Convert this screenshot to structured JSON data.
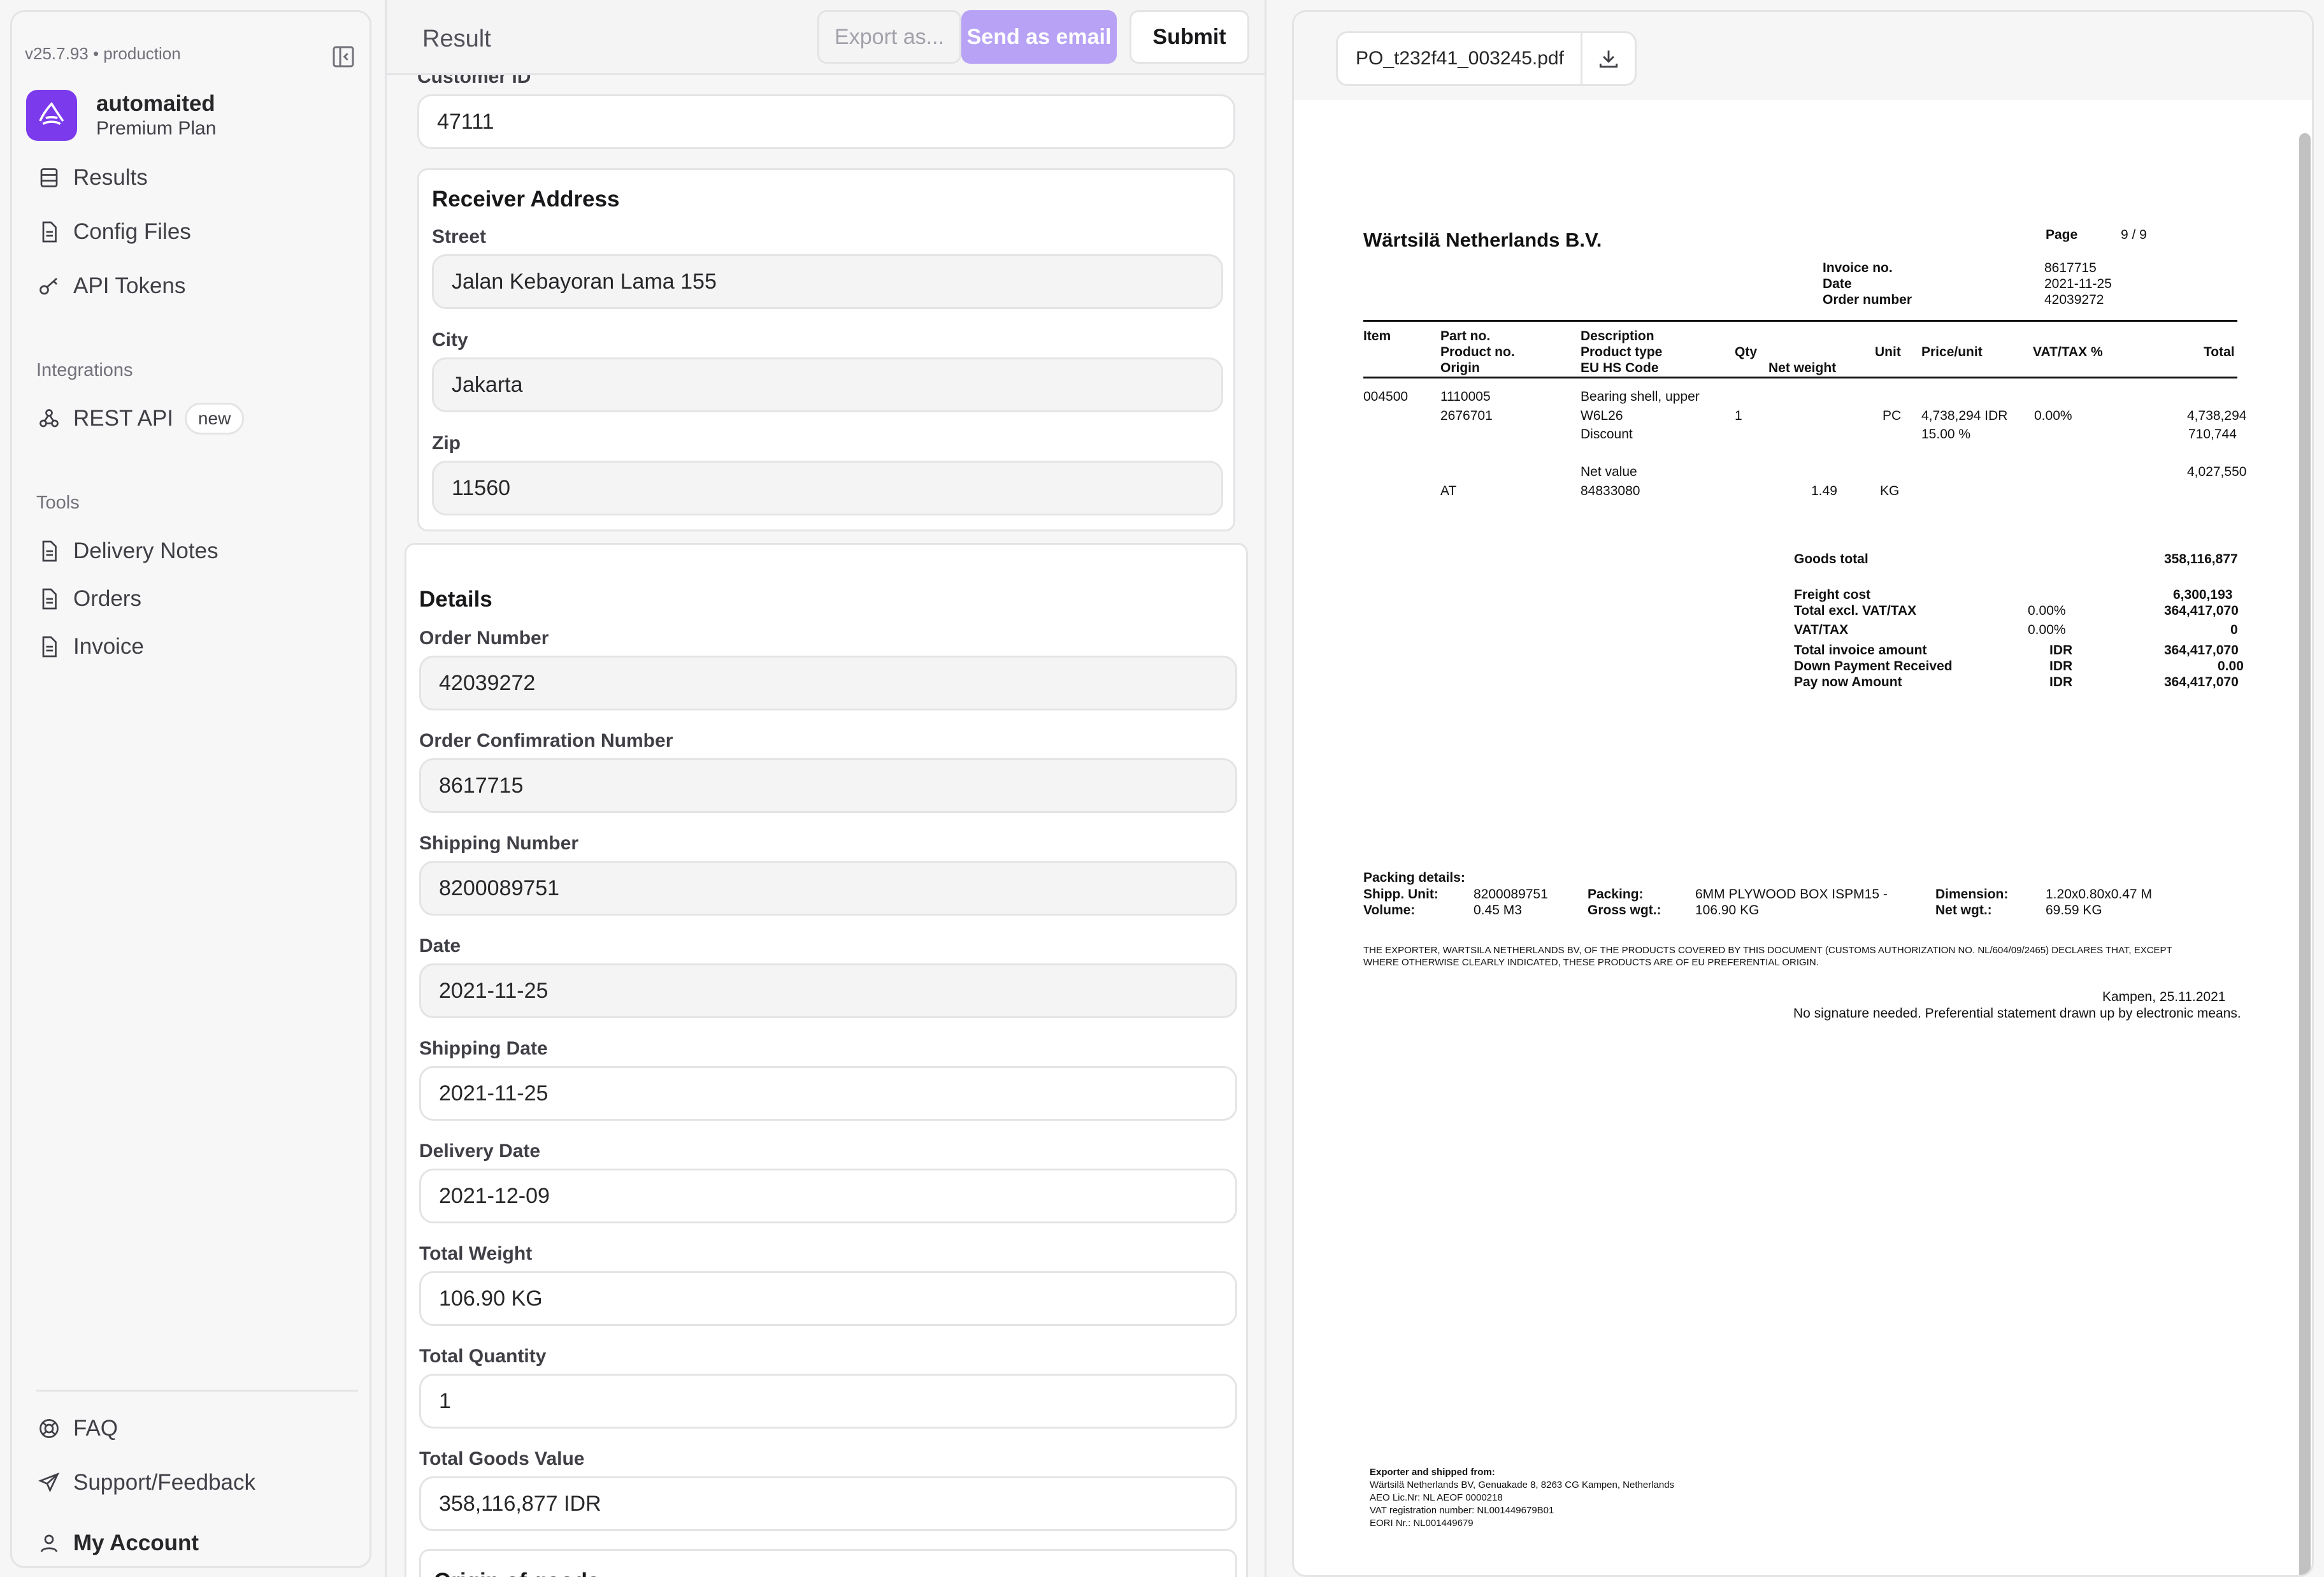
{
  "sidebar": {
    "version": "v25.7.93 • production",
    "brand_name": "automaited",
    "brand_plan": "Premium Plan",
    "main_nav": [
      "Results",
      "Config Files",
      "API Tokens"
    ],
    "integrations_title": "Integrations",
    "rest_api": "REST API",
    "rest_api_badge": "new",
    "tools_title": "Tools",
    "tools": [
      "Delivery Notes",
      "Orders",
      "Invoice"
    ],
    "bottom": [
      "FAQ",
      "Support/Feedback",
      "My Account"
    ]
  },
  "header": {
    "title": "Result",
    "export": "Export as...",
    "email": "Send as email",
    "submit": "Submit"
  },
  "form": {
    "customer_id_label": "Customer ID",
    "customer_id": "47111",
    "receiver_title": "Receiver Address",
    "street_label": "Street",
    "street": "Jalan Kebayoran Lama 155",
    "city_label": "City",
    "city": "Jakarta",
    "zip_label": "Zip",
    "zip": "11560",
    "details_title": "Details",
    "order_number_label": "Order Number",
    "order_number": "42039272",
    "order_conf_label": "Order Confimration Number",
    "order_conf": "8617715",
    "shipping_number_label": "Shipping Number",
    "shipping_number": "8200089751",
    "date_label": "Date",
    "date": "2021-11-25",
    "shipping_date_label": "Shipping Date",
    "shipping_date": "2021-11-25",
    "delivery_date_label": "Delivery Date",
    "delivery_date": "2021-12-09",
    "total_weight_label": "Total Weight",
    "total_weight": "106.90 KG",
    "total_qty_label": "Total Quantity",
    "total_qty": "1",
    "total_goods_label": "Total Goods Value",
    "total_goods": "358,116,877 IDR",
    "origin_title": "Origin of goods"
  },
  "pdf": {
    "filename": "PO_t232f41_003245.pdf",
    "company": "Wärtsilä Netherlands B.V.",
    "page_label": "Page",
    "page_value": "9 / 9",
    "invoice_no_label": "Invoice no.",
    "invoice_no": "8617715",
    "date_label": "Date",
    "date": "2021-11-25",
    "order_number_label": "Order number",
    "order_number": "42039272",
    "col_item": "Item",
    "col_part": "Part no.",
    "col_product_no": "Product no.",
    "col_origin": "Origin",
    "col_description": "Description",
    "col_product_type": "Product type",
    "col_hs": "EU HS Code",
    "col_qty": "Qty",
    "col_net_weight": "Net weight",
    "col_unit": "Unit",
    "col_price": "Price/unit",
    "col_vat": "VAT/TAX %",
    "col_total": "Total",
    "row_item": "004500",
    "row_part": "1110005",
    "row_desc": "Bearing shell, upper",
    "row_product_no": "2676701",
    "row_type": "W6L26",
    "row_qty": "1",
    "row_unit": "PC",
    "row_price": "4,738,294 IDR",
    "row_vat": "0.00%",
    "row_total": "4,738,294",
    "discount_label": "Discount",
    "discount_pct": "15.00 %",
    "discount_value": "710,744",
    "net_value_label": "Net value",
    "net_value": "4,027,550",
    "row_origin": "AT",
    "row_hs": "84833080",
    "row_weight": "1.49",
    "row_weight_unit": "KG",
    "goods_total_label": "Goods total",
    "goods_total": "358,116,877",
    "freight_label": "Freight cost",
    "freight": "6,300,193",
    "excl_label": "Total excl. VAT/TAX",
    "excl_pct": "0.00%",
    "excl": "364,417,070",
    "vat_label": "VAT/TAX",
    "vat_pct": "0.00%",
    "vat": "0",
    "invoice_amount_label": "Total invoice amount",
    "invoice_amount_cur": "IDR",
    "invoice_amount": "364,417,070",
    "down_label": "Down Payment Received",
    "down_cur": "IDR",
    "down": "0.00",
    "paynow_label": "Pay now Amount",
    "paynow_cur": "IDR",
    "paynow": "364,417,070",
    "packing_title": "Packing details:",
    "shipp_unit_label": "Shipp. Unit:",
    "shipp_unit": "8200089751",
    "packing_label": "Packing:",
    "packing": "6MM PLYWOOD BOX ISPM15 -",
    "dimension_label": "Dimension:",
    "dimension": "1.20x0.80x0.47 M",
    "volume_label": "Volume:",
    "volume": "0.45 M3",
    "gross_label": "Gross wgt.:",
    "gross": "106.90 KG",
    "net_label": "Net wgt.:",
    "net": "69.59 KG",
    "statement_1": "THE EXPORTER, WARTSILA NETHERLANDS BV, OF THE PRODUCTS COVERED BY THIS DOCUMENT (CUSTOMS AUTHORIZATION NO. NL/604/09/2465) DECLARES THAT, EXCEPT",
    "statement_2": "WHERE OTHERWISE CLEARLY INDICATED, THESE PRODUCTS ARE OF EU PREFERENTIAL ORIGIN.",
    "place_date": "Kampen, 25.11.2021",
    "signature_note": "No signature needed. Preferential statement drawn up by electronic means.",
    "footer_title": "Exporter and shipped from:",
    "footer_1": "Wärtsilä Netherlands BV, Genuakade 8, 8263 CG Kampen, Netherlands",
    "footer_2": "AEO Lic.Nr: NL AEOF 0000218",
    "footer_3": "VAT registration number: NL001449679B01",
    "footer_4": "EORI Nr.: NL001449679"
  }
}
